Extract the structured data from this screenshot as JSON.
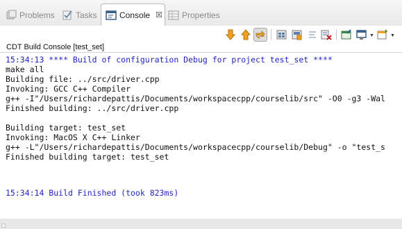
{
  "tabs": [
    {
      "label": "Problems",
      "icon": "problems-icon",
      "active": false
    },
    {
      "label": "Tasks",
      "icon": "tasks-icon",
      "active": false
    },
    {
      "label": "Console",
      "icon": "console-icon",
      "active": true,
      "close_glyph": "☒"
    },
    {
      "label": "Properties",
      "icon": "properties-icon",
      "active": false
    }
  ],
  "toolbar": {
    "buttons": [
      "next-error-icon",
      "previous-error-icon",
      "link-with-editor-icon",
      "copy-build-log-icon",
      "save-console-icon",
      "clear-console-icon",
      "scroll-lock-icon",
      "pin-console-icon",
      "display-console-icon",
      "new-console-icon"
    ],
    "pressed": "link-with-editor-icon"
  },
  "console": {
    "title": "CDT Build Console [test_set]",
    "lines": [
      {
        "text": "15:34:13 **** Build of configuration Debug for project test_set ****",
        "color": "blue"
      },
      {
        "text": "make all",
        "color": "black"
      },
      {
        "text": "Building file: ../src/driver.cpp",
        "color": "black"
      },
      {
        "text": "Invoking: GCC C++ Compiler",
        "color": "black"
      },
      {
        "text": "g++ -I\"/Users/richardepattis/Documents/workspacecpp/courselib/src\" -O0 -g3 -Wal",
        "color": "black"
      },
      {
        "text": "Finished building: ../src/driver.cpp",
        "color": "black"
      },
      {
        "text": "",
        "color": "black"
      },
      {
        "text": "Building target: test_set",
        "color": "black"
      },
      {
        "text": "Invoking: MacOS X C++ Linker",
        "color": "black"
      },
      {
        "text": "g++ -L\"/Users/richardepattis/Documents/workspacecpp/courselib/Debug\" -o \"test_s",
        "color": "black"
      },
      {
        "text": "Finished building target: test_set",
        "color": "black"
      },
      {
        "text": "",
        "color": "black"
      },
      {
        "text": "",
        "color": "black"
      },
      {
        "text": "15:34:14 Build Finished (took 823ms)",
        "color": "blue"
      }
    ]
  },
  "colors": {
    "console_blue": "#2323c8",
    "accent_orange": "#f0a020"
  }
}
